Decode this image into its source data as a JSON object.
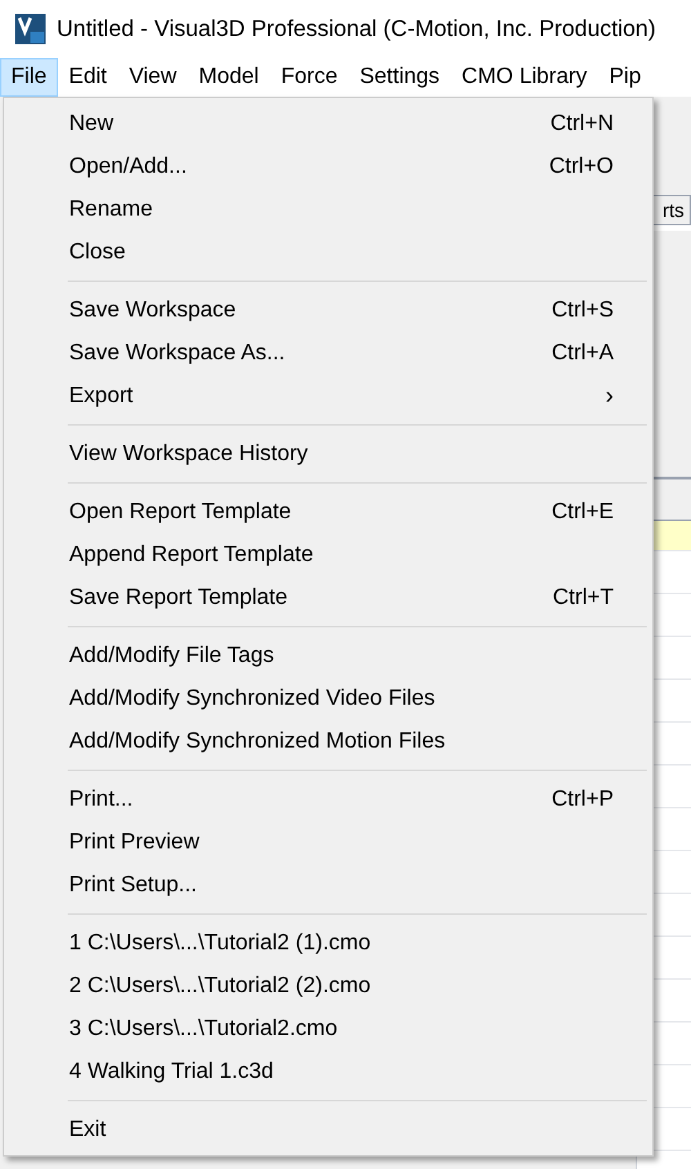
{
  "window": {
    "title": "Untitled - Visual3D Professional (C-Motion, Inc. Production)"
  },
  "menu_bar": [
    {
      "label": "File",
      "selected": true
    },
    {
      "label": "Edit",
      "selected": false
    },
    {
      "label": "View",
      "selected": false
    },
    {
      "label": "Model",
      "selected": false
    },
    {
      "label": "Force",
      "selected": false
    },
    {
      "label": "Settings",
      "selected": false
    },
    {
      "label": "CMO Library",
      "selected": false
    },
    {
      "label": "Pip",
      "selected": false
    }
  ],
  "background": {
    "tab_label": "rts"
  },
  "file_menu": [
    [
      {
        "label": "New",
        "shortcut": "Ctrl+N"
      },
      {
        "label": "Open/Add...",
        "shortcut": "Ctrl+O"
      },
      {
        "label": "Rename"
      },
      {
        "label": "Close"
      }
    ],
    [
      {
        "label": "Save Workspace",
        "shortcut": "Ctrl+S"
      },
      {
        "label": "Save Workspace As...",
        "shortcut": "Ctrl+A"
      },
      {
        "label": "Export",
        "submenu_arrow": "›"
      }
    ],
    [
      {
        "label": "View Workspace History"
      }
    ],
    [
      {
        "label": "Open Report Template",
        "shortcut": "Ctrl+E"
      },
      {
        "label": "Append Report Template"
      },
      {
        "label": "Save Report Template",
        "shortcut": "Ctrl+T"
      }
    ],
    [
      {
        "label": "Add/Modify File Tags"
      },
      {
        "label": "Add/Modify Synchronized Video Files"
      },
      {
        "label": "Add/Modify Synchronized Motion Files"
      }
    ],
    [
      {
        "label": "Print...",
        "shortcut": "Ctrl+P"
      },
      {
        "label": "Print Preview"
      },
      {
        "label": "Print Setup..."
      }
    ],
    [
      {
        "label": "1 C:\\Users\\...\\Tutorial2 (1).cmo"
      },
      {
        "label": "2 C:\\Users\\...\\Tutorial2 (2).cmo"
      },
      {
        "label": "3 C:\\Users\\...\\Tutorial2.cmo"
      },
      {
        "label": "4 Walking Trial 1.c3d"
      }
    ],
    [
      {
        "label": "Exit"
      }
    ]
  ]
}
